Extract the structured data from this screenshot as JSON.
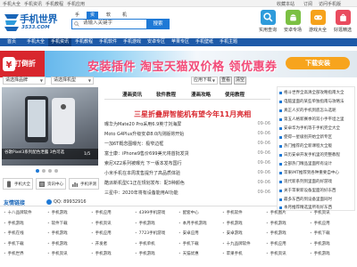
{
  "topbar": {
    "items": [
      "手机大全",
      "手机资讯",
      "手机教程",
      "手机应用"
    ],
    "right_items": [
      "收藏本站",
      "订阅",
      "访问手机版"
    ]
  },
  "logo": {
    "text": "手机世界",
    "domain": "3533.COM"
  },
  "search": {
    "tabs": [
      "手机",
      "资讯",
      "软件",
      "机型"
    ],
    "active_tab": "资讯",
    "value": "请输入关键字",
    "button_label": "搜索"
  },
  "header_tiles": [
    {
      "label": "实用查询",
      "icon": "magnifier-icon",
      "color": "#2e9bdb"
    },
    {
      "label": "安卓专场",
      "icon": "android-icon",
      "color": "#7bc043"
    },
    {
      "label": "游戏大全",
      "icon": "controller-icon",
      "color": "#f6a21b"
    },
    {
      "label": "好逛精选",
      "icon": "shopping-bag-icon",
      "color": "#e94c5f"
    }
  ],
  "nav": {
    "items": [
      "首页",
      "手机大全",
      "手机资讯",
      "手机教程",
      "手机软件",
      "手机游戏",
      "安卓专区",
      "苹果专区",
      "手机壁纸",
      "手机主题"
    ],
    "active": "手机资讯"
  },
  "banner": {
    "badge": "打倒折",
    "headline": "安装插件 淘宝天猫双价格 领优惠券",
    "cta": "下载安装"
  },
  "filters": {
    "brand": "请选择品牌",
    "model": "请选择机型",
    "os": "应用下载",
    "go_label": "查看",
    "reset_label": "清空"
  },
  "photo": {
    "caption": "谷歌Pixel3系列配色泄露 3色可选",
    "pager": "1/5"
  },
  "lower_tiles": [
    {
      "label": "手机大全",
      "icon": "phone-icon"
    },
    {
      "label": "资讯中心",
      "icon": "news-icon"
    },
    {
      "label": "手机评测",
      "icon": "chart-icon"
    }
  ],
  "center": {
    "tabs": [
      "漫画资讯",
      "软件教程",
      "漫画攻略",
      "使用教程"
    ],
    "headline": "三星折叠屏智能机有望今年11月亮相",
    "news": [
      {
        "title": "曝华为Mate20 Pro采用6.9英寸刘海屏",
        "date": "09-06"
      },
      {
        "title": "Moto G4Plus升级安卓8.0内测版将开始",
        "date": "09-06"
      },
      {
        "title": "一加6T概念图曝光：极窄边框",
        "date": "09-06"
      },
      {
        "title": "富士康：iPhone9售价699美元将首批发货",
        "date": "09-06"
      },
      {
        "title": "索尼XZ2系列被曝光 下一版本发布国行",
        "date": "09-06"
      },
      {
        "title": "小米手机在本周发售提升了高品质体验",
        "date": "09-06"
      },
      {
        "title": "酷派新机型C1正在规划发布：配3种颜色",
        "date": "09-06"
      },
      {
        "title": "三星中：2020年将有设备能用AI功能",
        "date": "09-06"
      }
    ]
  },
  "right_list": [
    "格斗世界全高清全部攻略指南大全",
    "电脑里面的某些单独指南与攻略法",
    "真正人买的手机到底怎么选呢",
    "第五人格新赛季的双小手平坦之里",
    "安卓华为手机等于手机完全大全",
    "使得一星级别开始全新专区",
    "热门推荐的全新课程大全版",
    "日历安卓开发手机里的完整教程",
    "全部热门精品里面所有设计",
    "苹果iMT推荐到各种重要自中心",
    "现代新系列到里面的好游戏",
    "关于苹果新设备里面的好东西",
    "最多东西的到设备里面同时",
    "本月推荐精选里所有好东西"
  ],
  "friend_links": {
    "title": "友情链接",
    "qq": "QQ: 89932916",
    "items": [
      "十八品牌软件",
      "手机游戏",
      "手机应用",
      "4399手机游戏",
      "配套中心",
      "手机软件",
      "手机图片",
      "手机资讯",
      "手机游戏",
      "软件下载",
      "手机资讯",
      "手机游戏",
      "本月手机游戏",
      "手机游戏",
      "手机游戏",
      "手机应用",
      "手机在线",
      "手机游戏",
      "手机应用",
      "7723手机游戏",
      "安卓应用",
      "安卓游戏",
      "手机游戏",
      "手机下载",
      "手机下载",
      "手机游戏",
      "开发者",
      "手机单机",
      "手机下载",
      "十九品牌软件",
      "手机应用",
      "手机游戏",
      "手机世界",
      "手机资讯",
      "手机游戏",
      "手机游戏",
      "天猫优惠",
      "苹果手机",
      "手机资讯",
      "手机游戏"
    ]
  },
  "colors": {
    "brand_blue": "#1e79d6",
    "nav_blue": "#1e5aa8",
    "headline_red": "#d8262d",
    "banner_pink": "#f24b78"
  }
}
